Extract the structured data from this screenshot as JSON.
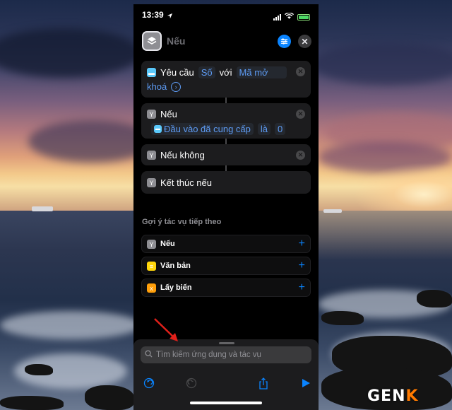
{
  "status_bar": {
    "time": "13:39"
  },
  "header": {
    "title": "Nếu"
  },
  "actions": {
    "request": {
      "verb": "Yêu cầu",
      "token_type": "Số",
      "connector": "với",
      "token_passcode_line1": "Mã mở",
      "token_passcode_line2": "khoá"
    },
    "if_block": {
      "label": "Nếu",
      "token_input": "Đầu vào đã cung cấp",
      "token_condition": "là",
      "token_value": "0"
    },
    "otherwise": {
      "label": "Nếu không"
    },
    "end_if": {
      "label": "Kết thúc nếu"
    }
  },
  "suggestions": {
    "title": "Gợi ý tác vụ tiếp theo",
    "items": [
      {
        "label": "Nếu"
      },
      {
        "label": "Văn bản"
      },
      {
        "label": "Lấy biến"
      }
    ]
  },
  "search": {
    "placeholder": "Tìm kiếm ứng dụng và tác vụ"
  },
  "watermark": {
    "text_main": "GEN",
    "text_accent": "K"
  },
  "colors": {
    "accent": "#0a84ff",
    "annotation_arrow": "#e0201a"
  }
}
